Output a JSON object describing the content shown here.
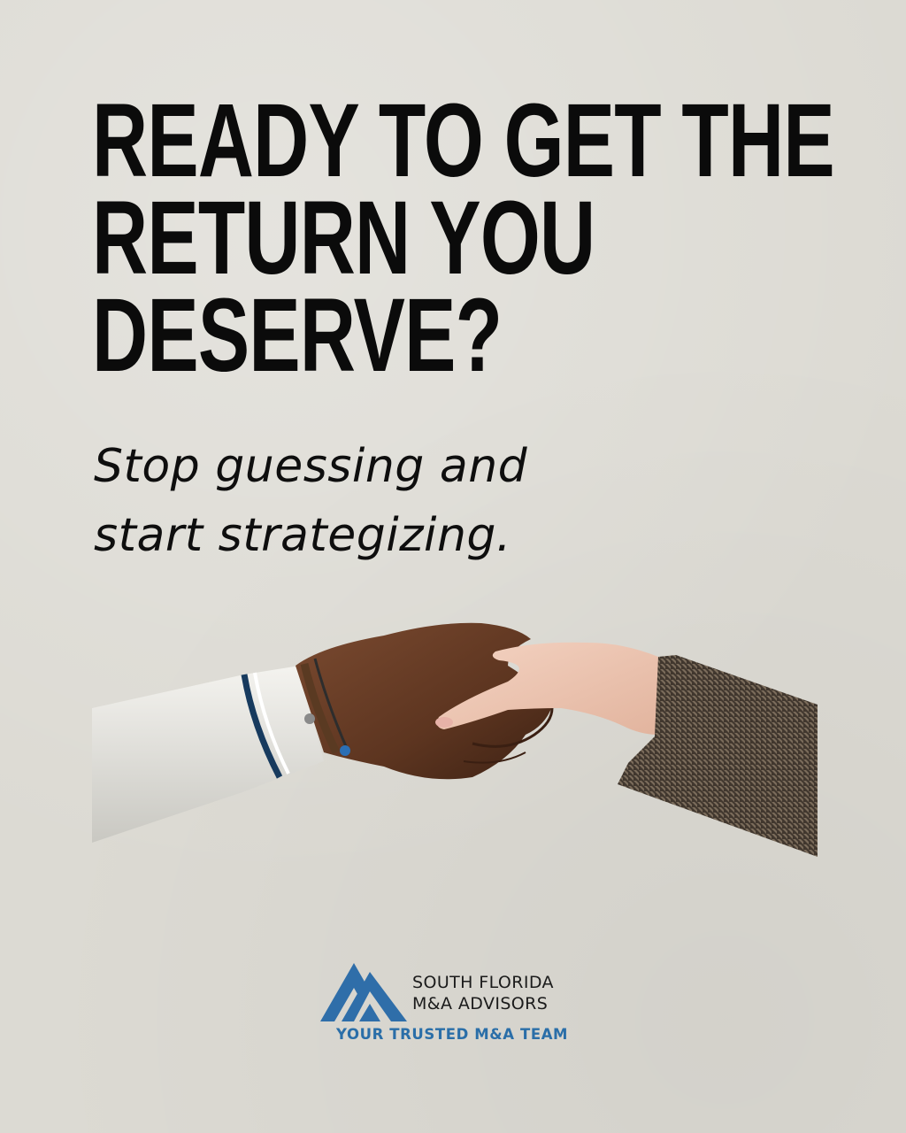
{
  "headline": {
    "line1": "READY TO GET THE",
    "line2": "RETURN YOU",
    "line3": "DESERVE?"
  },
  "subheadline": {
    "line1": "Stop guessing and",
    "line2": "start strategizing."
  },
  "image": {
    "subject": "handshake-photo"
  },
  "brand": {
    "name_line1": "SOUTH FLORIDA",
    "name_line2": "M&A ADVISORS",
    "tagline": "YOUR TRUSTED M&A TEAM",
    "logo_icon": "mountain-logo-icon",
    "colors": {
      "primary_blue": "#2a6ea8",
      "logo_blue": "#2f6ea9",
      "text_dark": "#1b1b1b"
    }
  },
  "colors": {
    "background": "#dcdad3",
    "headline": "#0b0b0b"
  }
}
